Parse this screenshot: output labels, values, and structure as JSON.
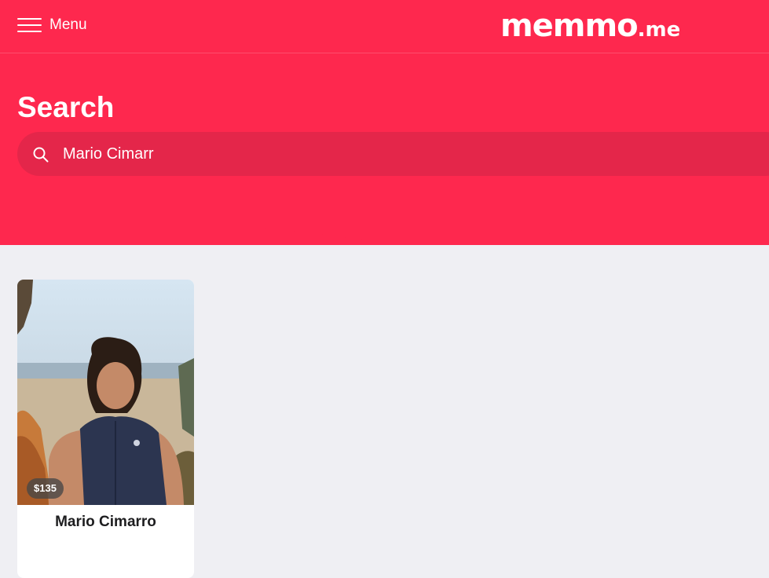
{
  "header": {
    "menu_label": "Menu",
    "logo": {
      "main": "memmo",
      "tld": ".me"
    },
    "title": "Search"
  },
  "search": {
    "value": "Mario Cimarr",
    "placeholder": ""
  },
  "results": [
    {
      "name": "Mario Cimarro",
      "price": "$135"
    }
  ],
  "colors": {
    "brand": "#fe284e",
    "search_bg": "#e4264a",
    "page_bg": "#efeff3"
  }
}
